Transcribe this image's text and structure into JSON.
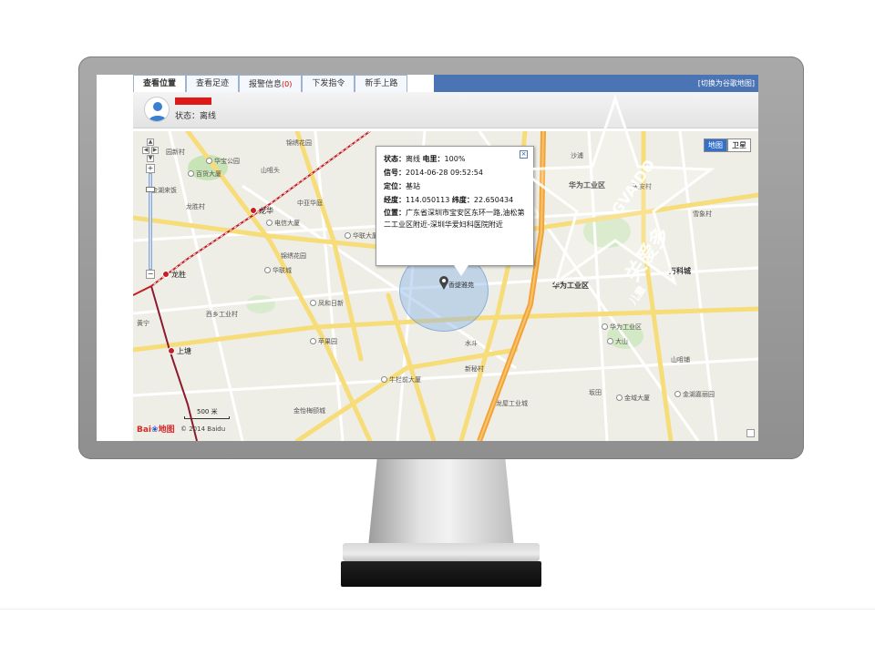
{
  "tabs": [
    {
      "label": "查看位置",
      "active": true
    },
    {
      "label": "查看足迹",
      "active": false
    },
    {
      "label": "报警信息",
      "badge": "(0)",
      "active": false
    },
    {
      "label": "下发指令",
      "active": false
    },
    {
      "label": "新手上路",
      "active": false
    }
  ],
  "switch_link": "[切换为谷歌地图]",
  "device": {
    "status_label": "状态：",
    "status_value": "离线",
    "name_color": "#e01818"
  },
  "map_type": {
    "map": "地图",
    "satellite": "卫星"
  },
  "popup": {
    "status_label": "状态：",
    "status_value": "离线",
    "battery_label": "电里：",
    "battery_value": "100%",
    "signal_label": "信号：",
    "signal_value": "2014-06-28 09:52:54",
    "locate_label": "定位：",
    "locate_value": "基站",
    "lon_label": "经度：",
    "lon_value": "114.050113",
    "lat_label": "纬度：",
    "lat_value": "22.650434",
    "addr_label": "位置：",
    "addr_value": "广东省深圳市宝安区东环一路,油松第二工业区附近-深圳华爱妇科医院附近",
    "close": "×"
  },
  "marker_label": "香缇雅苑",
  "places": [
    {
      "t": "园新村"
    },
    {
      "t": "华宝公园"
    },
    {
      "t": "锦绣花园"
    },
    {
      "t": "山咀头"
    },
    {
      "t": "百货大厦"
    },
    {
      "t": "金湖来饭"
    },
    {
      "t": "龙胜村"
    },
    {
      "t": "中亚华庭"
    },
    {
      "t": "电信大厦"
    },
    {
      "t": "华联大厦"
    },
    {
      "t": "锦绣花园"
    },
    {
      "t": "华联城"
    },
    {
      "t": "西乡工业村"
    },
    {
      "t": "凤和日新"
    },
    {
      "t": "苹果园"
    },
    {
      "t": "黄宁"
    },
    {
      "t": "牛栏前大厦"
    },
    {
      "t": "金怡梅颐城"
    },
    {
      "t": "水斗"
    },
    {
      "t": "新秘村"
    },
    {
      "t": "龙屋工业城"
    },
    {
      "t": "华为工业区"
    },
    {
      "t": "沙浦"
    },
    {
      "t": "天安村"
    },
    {
      "t": "万科城"
    },
    {
      "t": "大山"
    },
    {
      "t": "山咀铺"
    },
    {
      "t": "金域大厦"
    },
    {
      "t": "金湖嘉丽园"
    },
    {
      "t": "雪象村"
    },
    {
      "t": "华为工业区"
    },
    {
      "t": "坂田"
    },
    {
      "t": "华为工业区"
    }
  ],
  "metro": [
    {
      "t": "龙华"
    },
    {
      "t": "龙胜"
    },
    {
      "t": "上塘"
    }
  ],
  "scale": "500 米",
  "logo": "Bai",
  "logo2": "地图",
  "copyright": "© 2014 Baidu",
  "watermark": {
    "line1": "GVAIDO",
    "line2": "关爱多",
    "line3": "儿童"
  }
}
